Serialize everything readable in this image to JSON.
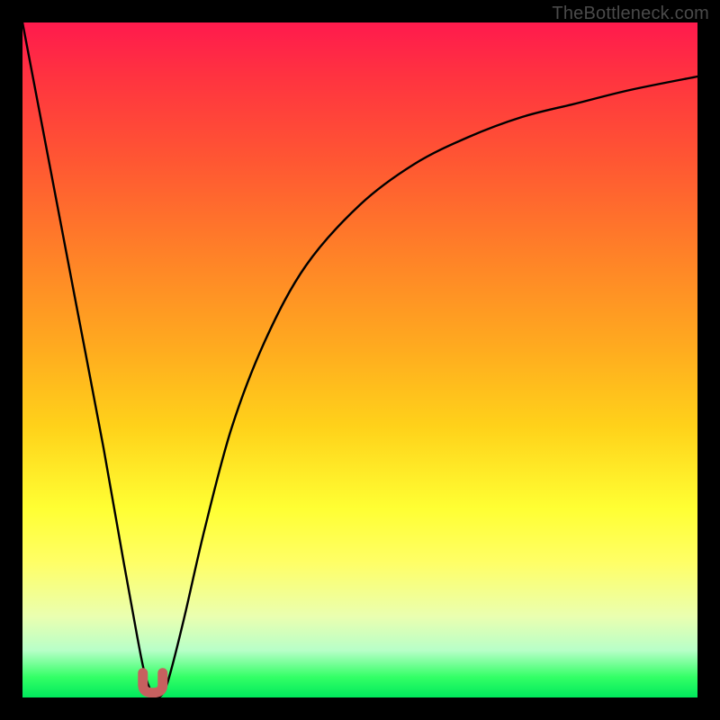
{
  "watermark": "TheBottleneck.com",
  "chart_data": {
    "type": "line",
    "title": "",
    "xlabel": "",
    "ylabel": "",
    "xlim": [
      0,
      100
    ],
    "ylim": [
      0,
      100
    ],
    "series": [
      {
        "name": "bottleneck-curve",
        "x": [
          0,
          4,
          8,
          12,
          15,
          17,
          18,
          19,
          20,
          21,
          22,
          24,
          27,
          31,
          36,
          42,
          50,
          58,
          66,
          74,
          82,
          90,
          100
        ],
        "y": [
          100,
          79,
          58,
          37,
          20,
          9,
          4,
          1,
          0,
          1,
          4,
          12,
          25,
          40,
          53,
          64,
          73,
          79,
          83,
          86,
          88,
          90,
          92
        ]
      }
    ],
    "marker": {
      "name": "optimal-point",
      "x": 19.3,
      "y": 1.5,
      "color": "#c6605f",
      "shape": "U"
    },
    "gradient_meaning": "green=low bottleneck, red=high bottleneck"
  }
}
